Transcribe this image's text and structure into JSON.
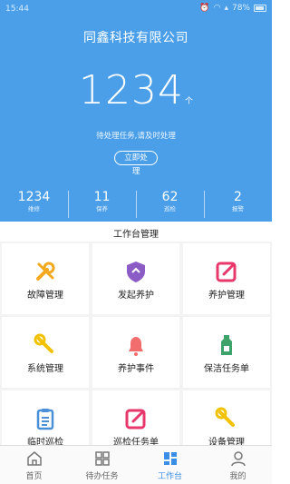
{
  "status_bar": {
    "time": "15:44",
    "battery": "78%"
  },
  "header": {
    "company": "同鑫科技有限公司",
    "pending_count": "1234",
    "pending_unit": "个",
    "hint": "待处理任务,请及时处理",
    "handle_button_line1": "立即处",
    "handle_button_line2": "理"
  },
  "stats": [
    {
      "value": "1234",
      "label": "维修"
    },
    {
      "value": "11",
      "label": "保养"
    },
    {
      "value": "62",
      "label": "巡检"
    },
    {
      "value": "2",
      "label": "报警"
    }
  ],
  "section_title": "工作台管理",
  "grid_items": [
    {
      "label": "故障管理",
      "icon": "wrench-icon",
      "color": "#f4a81d"
    },
    {
      "label": "发起养护",
      "icon": "shield-icon",
      "color": "#8b5cc6"
    },
    {
      "label": "养护管理",
      "icon": "edit-icon",
      "color": "#e8376b"
    },
    {
      "label": "系统管理",
      "icon": "wrench-icon",
      "color": "#f2c200"
    },
    {
      "label": "养护事件",
      "icon": "bell-icon",
      "color": "#f26d6d"
    },
    {
      "label": "保洁任务单",
      "icon": "bottle-icon",
      "color": "#3ea36b"
    },
    {
      "label": "临时巡检",
      "icon": "clipboard-icon",
      "color": "#4a90d9"
    },
    {
      "label": "巡检任务单",
      "icon": "edit-icon",
      "color": "#e8376b"
    },
    {
      "label": "设备管理",
      "icon": "wrench-icon",
      "color": "#f2c200"
    }
  ],
  "tabbar": [
    {
      "label": "首页",
      "icon": "home-icon",
      "active": false
    },
    {
      "label": "待办任务",
      "icon": "grid-icon",
      "active": false
    },
    {
      "label": "工作台",
      "icon": "dashboard-icon",
      "active": true
    },
    {
      "label": "我的",
      "icon": "user-icon",
      "active": false
    }
  ],
  "colors": {
    "primary": "#4a9fe8",
    "active_tab": "#3a8ee6"
  }
}
